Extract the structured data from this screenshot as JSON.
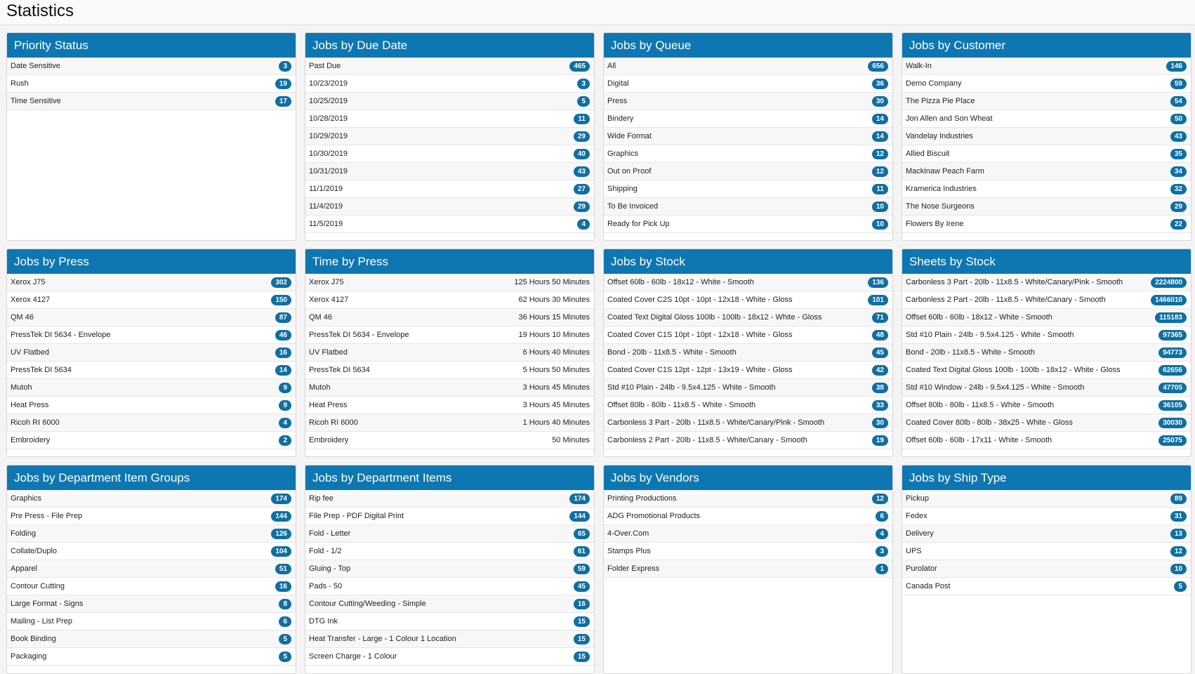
{
  "page": {
    "title": "Statistics"
  },
  "panels": [
    {
      "id": "priority-status",
      "title": "Priority Status",
      "kind": "badge",
      "rows": [
        {
          "label": "Date Sensitive",
          "value": "3"
        },
        {
          "label": "Rush",
          "value": "19"
        },
        {
          "label": "Time Sensitive",
          "value": "17"
        }
      ]
    },
    {
      "id": "jobs-by-due-date",
      "title": "Jobs by Due Date",
      "kind": "badge",
      "rows": [
        {
          "label": "Past Due",
          "value": "465"
        },
        {
          "label": "10/23/2019",
          "value": "3"
        },
        {
          "label": "10/25/2019",
          "value": "5"
        },
        {
          "label": "10/28/2019",
          "value": "11"
        },
        {
          "label": "10/29/2019",
          "value": "29"
        },
        {
          "label": "10/30/2019",
          "value": "40"
        },
        {
          "label": "10/31/2019",
          "value": "43"
        },
        {
          "label": "11/1/2019",
          "value": "27"
        },
        {
          "label": "11/4/2019",
          "value": "29"
        },
        {
          "label": "11/5/2019",
          "value": "4"
        }
      ]
    },
    {
      "id": "jobs-by-queue",
      "title": "Jobs by Queue",
      "kind": "badge",
      "rows": [
        {
          "label": "All",
          "value": "656"
        },
        {
          "label": "Digital",
          "value": "36"
        },
        {
          "label": "Press",
          "value": "30"
        },
        {
          "label": "Bindery",
          "value": "14"
        },
        {
          "label": "Wide Format",
          "value": "14"
        },
        {
          "label": "Graphics",
          "value": "12"
        },
        {
          "label": "Out on Proof",
          "value": "12"
        },
        {
          "label": "Shipping",
          "value": "11"
        },
        {
          "label": "To Be Invoiced",
          "value": "10"
        },
        {
          "label": "Ready for Pick Up",
          "value": "10"
        }
      ]
    },
    {
      "id": "jobs-by-customer",
      "title": "Jobs by Customer",
      "kind": "badge",
      "rows": [
        {
          "label": "Walk-In",
          "value": "146"
        },
        {
          "label": "Demo Company",
          "value": "59"
        },
        {
          "label": "The Pizza Pie Place",
          "value": "54"
        },
        {
          "label": "Jon Allen and Son Wheat",
          "value": "50"
        },
        {
          "label": "Vandelay Industries",
          "value": "43"
        },
        {
          "label": "Allied Biscuit",
          "value": "35"
        },
        {
          "label": "Mackinaw Peach Farm",
          "value": "34"
        },
        {
          "label": "Kramerica Industries",
          "value": "32"
        },
        {
          "label": "The Nose Surgeons",
          "value": "29"
        },
        {
          "label": "Flowers By Irene",
          "value": "22"
        }
      ]
    },
    {
      "id": "jobs-by-press",
      "title": "Jobs by Press",
      "kind": "badge",
      "rows": [
        {
          "label": "Xerox J75",
          "value": "302"
        },
        {
          "label": "Xerox 4127",
          "value": "150"
        },
        {
          "label": "QM 46",
          "value": "87"
        },
        {
          "label": "PressTek DI 5634 - Envelope",
          "value": "46"
        },
        {
          "label": "UV Flatbed",
          "value": "16"
        },
        {
          "label": "PressTek DI 5634",
          "value": "14"
        },
        {
          "label": "Mutoh",
          "value": "9"
        },
        {
          "label": "Heat Press",
          "value": "9"
        },
        {
          "label": "Ricoh RI 6000",
          "value": "4"
        },
        {
          "label": "Embroidery",
          "value": "2"
        }
      ]
    },
    {
      "id": "time-by-press",
      "title": "Time by Press",
      "kind": "plain",
      "rows": [
        {
          "label": "Xerox J75",
          "value": "125 Hours 50 Minutes"
        },
        {
          "label": "Xerox 4127",
          "value": "62 Hours 30 Minutes"
        },
        {
          "label": "QM 46",
          "value": "36 Hours 15 Minutes"
        },
        {
          "label": "PressTek DI 5634 - Envelope",
          "value": "19 Hours 10 Minutes"
        },
        {
          "label": "UV Flatbed",
          "value": "6 Hours 40 Minutes"
        },
        {
          "label": "PressTek DI 5634",
          "value": "5 Hours 50 Minutes"
        },
        {
          "label": "Mutoh",
          "value": "3 Hours 45 Minutes"
        },
        {
          "label": "Heat Press",
          "value": "3 Hours 45 Minutes"
        },
        {
          "label": "Ricoh RI 6000",
          "value": "1 Hours 40 Minutes"
        },
        {
          "label": "Embroidery",
          "value": "50 Minutes"
        }
      ]
    },
    {
      "id": "jobs-by-stock",
      "title": "Jobs by Stock",
      "kind": "badge",
      "rows": [
        {
          "label": "Offset 60lb - 60lb - 18x12 - White - Smooth",
          "value": "136"
        },
        {
          "label": "Coated Cover C2S 10pt - 10pt - 12x18 - White - Gloss",
          "value": "101"
        },
        {
          "label": "Coated Text Digital Gloss 100lb - 100lb - 18x12 - White - Gloss",
          "value": "71"
        },
        {
          "label": "Coated Cover C1S 10pt - 10pt - 12x18 - White - Gloss",
          "value": "48"
        },
        {
          "label": "Bond - 20lb - 11x8.5 - White - Smooth",
          "value": "45"
        },
        {
          "label": "Coated Cover C1S 12pt - 12pt - 13x19 - White - Gloss",
          "value": "42"
        },
        {
          "label": "Std #10 Plain - 24lb - 9.5x4.125 - White - Smooth",
          "value": "38"
        },
        {
          "label": "Offset 80lb - 80lb - 11x8.5 - White - Smooth",
          "value": "33"
        },
        {
          "label": "Carbonless 3 Part - 20lb - 11x8.5 - White/Canary/Pink - Smooth",
          "value": "30"
        },
        {
          "label": "Carbonless 2 Part - 20lb - 11x8.5 - White/Canary - Smooth",
          "value": "19"
        }
      ]
    },
    {
      "id": "sheets-by-stock",
      "title": "Sheets by Stock",
      "kind": "badge",
      "rows": [
        {
          "label": "Carbonless 3 Part - 20lb - 11x8.5 - White/Canary/Pink - Smooth",
          "value": "2224800"
        },
        {
          "label": "Carbonless 2 Part - 20lb - 11x8.5 - White/Canary - Smooth",
          "value": "1466010"
        },
        {
          "label": "Offset 60lb - 60lb - 18x12 - White - Smooth",
          "value": "115183"
        },
        {
          "label": "Std #10 Plain - 24lb - 9.5x4.125 - White - Smooth",
          "value": "97365"
        },
        {
          "label": "Bond - 20lb - 11x8.5 - White - Smooth",
          "value": "94773"
        },
        {
          "label": "Coated Text Digital Gloss 100lb - 100lb - 18x12 - White - Gloss",
          "value": "62656"
        },
        {
          "label": "Std #10 Window - 24lb - 9.5x4.125 - White - Smooth",
          "value": "47705"
        },
        {
          "label": "Offset 80lb - 80lb - 11x8.5 - White - Smooth",
          "value": "36105"
        },
        {
          "label": "Coated Cover 80lb - 80lb - 38x25 - White - Gloss",
          "value": "30030"
        },
        {
          "label": "Offset 60lb - 60lb - 17x11 - White - Smooth",
          "value": "25075"
        }
      ]
    },
    {
      "id": "jobs-by-department-item-groups",
      "title": "Jobs by Department Item Groups",
      "kind": "badge",
      "rows": [
        {
          "label": "Graphics",
          "value": "174"
        },
        {
          "label": "Pre Press - File Prep",
          "value": "144"
        },
        {
          "label": "Folding",
          "value": "126"
        },
        {
          "label": "Collate/Duplo",
          "value": "104"
        },
        {
          "label": "Apparel",
          "value": "51"
        },
        {
          "label": "Contour Cutting",
          "value": "16"
        },
        {
          "label": "Large Format - Signs",
          "value": "8"
        },
        {
          "label": "Mailing - List Prep",
          "value": "6"
        },
        {
          "label": "Book Binding",
          "value": "5"
        },
        {
          "label": "Packaging",
          "value": "5"
        }
      ]
    },
    {
      "id": "jobs-by-department-items",
      "title": "Jobs by Department Items",
      "kind": "badge",
      "rows": [
        {
          "label": "Rip fee",
          "value": "174"
        },
        {
          "label": "File Prep - PDF Digital Print",
          "value": "144"
        },
        {
          "label": "Fold - Letter",
          "value": "65"
        },
        {
          "label": "Fold - 1/2",
          "value": "61"
        },
        {
          "label": "Gluing - Top",
          "value": "59"
        },
        {
          "label": "Pads - 50",
          "value": "45"
        },
        {
          "label": "Contour Cutting/Weeding - Simple",
          "value": "16"
        },
        {
          "label": "DTG Ink",
          "value": "15"
        },
        {
          "label": "Heat Transfer - Large - 1 Colour 1 Location",
          "value": "15"
        },
        {
          "label": "Screen Charge - 1 Colour",
          "value": "15"
        }
      ]
    },
    {
      "id": "jobs-by-vendors",
      "title": "Jobs by Vendors",
      "kind": "badge",
      "rows": [
        {
          "label": "Printing Productions",
          "value": "12"
        },
        {
          "label": "ADG Promotional Products",
          "value": "6"
        },
        {
          "label": "4-Over.Com",
          "value": "4"
        },
        {
          "label": "Stamps Plus",
          "value": "3"
        },
        {
          "label": "Folder Express",
          "value": "1"
        }
      ]
    },
    {
      "id": "jobs-by-ship-type",
      "title": "Jobs by Ship Type",
      "kind": "badge",
      "rows": [
        {
          "label": "Pickup",
          "value": "89"
        },
        {
          "label": "Fedex",
          "value": "31"
        },
        {
          "label": "Delivery",
          "value": "13"
        },
        {
          "label": "UPS",
          "value": "12"
        },
        {
          "label": "Purolator",
          "value": "10"
        },
        {
          "label": "Canada Post",
          "value": "5"
        }
      ]
    }
  ],
  "colors": {
    "header": "#0e77b1",
    "badge": "#0e6fa3"
  }
}
